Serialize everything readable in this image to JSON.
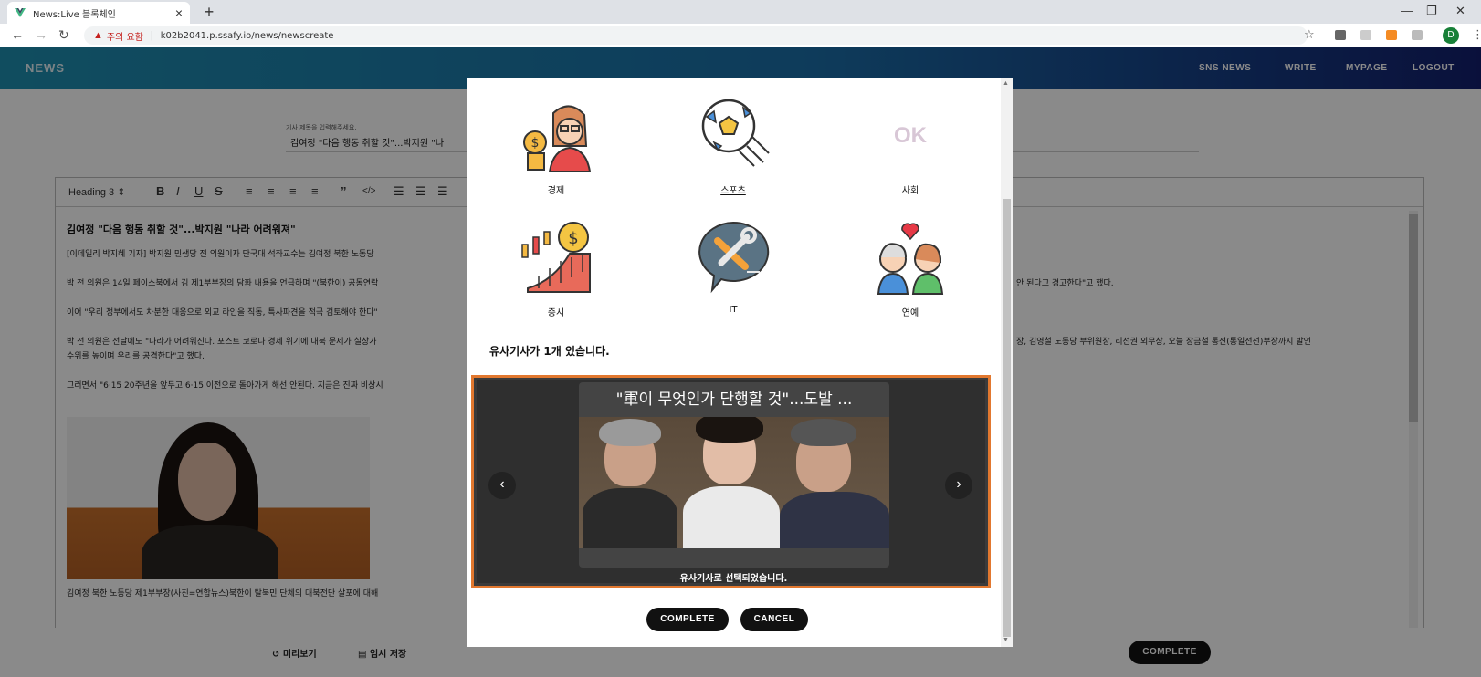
{
  "browser": {
    "tab_title": "News:Live 블록체인",
    "tab_close": "×",
    "new_tab": "+",
    "security_label": "주의 요함",
    "separator": "|",
    "url": "k02b2041.p.ssafy.io/news/newscreate",
    "profile_initial": "D"
  },
  "header": {
    "brand": "NEWS",
    "nav": [
      "SNS NEWS",
      "WRITE",
      "MYPAGE",
      "LOGOUT"
    ]
  },
  "editor": {
    "title_hint": "기사 제목을 입력해주세요.",
    "title_value": "김여정 \"다음 행동 취할 것\"...박지원 \"나",
    "heading_select": "Heading 3",
    "headline": "김여정 \"다음 행동 취할 것\"...박지원 \"나라 어려워져\"",
    "paragraphs": [
      "[이데일리 박지혜 기자] 박지원 민생당 전 의원이자 단국대 석좌교수는 김여정 북한 노동당",
      "박 전 의원은 14일 페이스북에서 김 제1부부장의 담화 내용을 언급하며 \"(북한이) 공동연락",
      "이어 \"우리 정부에서도 차분한 대응으로 외교 라인을 직동, 특사파견을 적극 검토해야 한다\"",
      "박 전 의원은 전날에도 \"나라가 어려워진다. 포스트 코로나 경제 위기에 대북 문제가 실상가",
      "수위를 높이며 우리를 공격한다\"고 했다.",
      "그러면서 \"6·15 20주년을 앞두고 6·15 이전으로 돌아가게 해선 안된다. 지금은 진짜 비상시"
    ],
    "right_fragments": [
      "안 된다고 경고한다\"고 했다.",
      "장, 김영철 노동당 부위원장, 리선권 외무상, 오늘 장금철 통전(통일전선)부장까지 발언"
    ],
    "caption": "김여정 북한 노동당 제1부부장(사진=연합뉴스)북한이 탈북민 단체의 대북전단 살포에 대해"
  },
  "bottom_bar": {
    "preview": "미리보기",
    "temp_save": "임시 저장",
    "complete": "COMPLETE"
  },
  "modal": {
    "categories": [
      {
        "label": "경제",
        "icon": "economy-icon"
      },
      {
        "label": "스포츠",
        "icon": "soccer-ball-icon"
      },
      {
        "label": "사회",
        "icon": "ok-icon"
      },
      {
        "label": "증시",
        "icon": "stock-chart-icon"
      },
      {
        "label": "IT",
        "icon": "it-tools-icon"
      },
      {
        "label": "연예",
        "icon": "entertainment-icon"
      }
    ],
    "ok_text": "OK",
    "similar_count_text": "유사기사가 1개 있습니다.",
    "carousel": {
      "title": "\"軍이 무엇인가 단행할 것\"...도발 ...",
      "selected_text": "유사기사로 선택되었습니다.",
      "prev": "‹",
      "next": "›"
    },
    "complete": "COMPLETE",
    "cancel": "CANCEL"
  }
}
